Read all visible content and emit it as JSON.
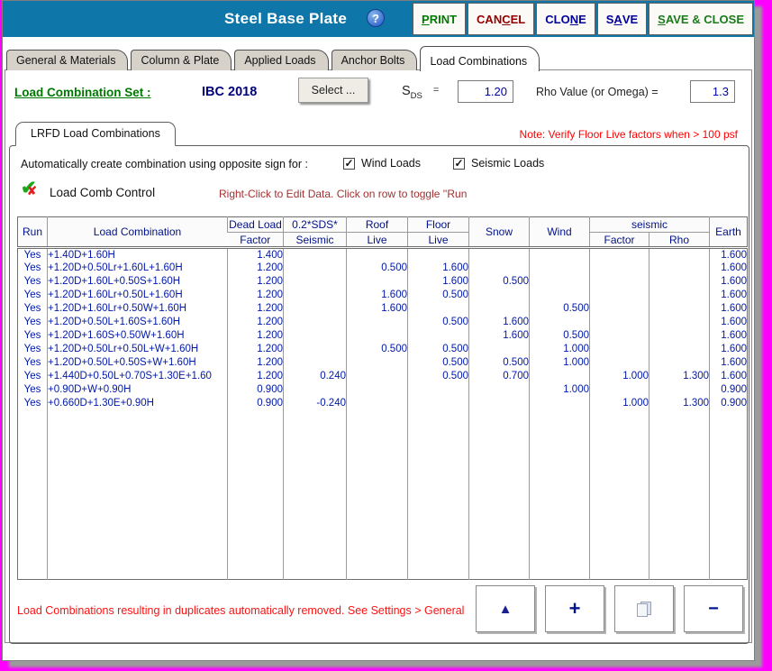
{
  "colors": {
    "titlebar": "#0F76A9",
    "desktop": "#FF00FF",
    "note_red": "#FF0000",
    "table_text": "#0018A8"
  },
  "titlebar": {
    "title": "Steel Base Plate",
    "help": "?",
    "buttons": [
      {
        "id": "print",
        "pre": "",
        "u": "P",
        "post": "RINT",
        "color": "#007A00"
      },
      {
        "id": "cancel",
        "pre": "CAN",
        "u": "C",
        "post": "EL",
        "color": "#8F0000"
      },
      {
        "id": "clone",
        "pre": "CLO",
        "u": "N",
        "post": "E",
        "color": "#000099"
      },
      {
        "id": "save",
        "pre": "S",
        "u": "A",
        "post": "VE",
        "color": "#000099"
      },
      {
        "id": "save-close",
        "pre": "",
        "u": "S",
        "post": "AVE & CLOSE",
        "color": "#1B7A1B"
      }
    ]
  },
  "tabs": [
    {
      "id": "general-materials",
      "label": "General & Materials",
      "active": false
    },
    {
      "id": "column-plate",
      "label": "Column & Plate",
      "active": false
    },
    {
      "id": "applied-loads",
      "label": "Applied Loads",
      "active": false
    },
    {
      "id": "anchor-bolts",
      "label": "Anchor Bolts",
      "active": false
    },
    {
      "id": "load-combinations",
      "label": "Load Combinations",
      "active": true
    }
  ],
  "fields": {
    "set_label": "Load Combination Set :",
    "set_value": "IBC 2018",
    "select_button": "Select ...",
    "sds": {
      "s": "S",
      "sub": "DS",
      "eq": "=",
      "value": "1.20"
    },
    "rho": {
      "label": "Rho Value (or Omega)  =",
      "value": "1.3"
    }
  },
  "lrfd": {
    "tab_label": "LRFD Load Combinations",
    "floor_note": "Note: Verify Floor Live factors when > 100 psf"
  },
  "auto_row": {
    "label": "Automatically create combination using opposite sign for :",
    "checkboxes": [
      {
        "id": "wind-loads",
        "label": "Wind Loads",
        "checked": true
      },
      {
        "id": "seismic-loads",
        "label": "Seismic Loads",
        "checked": true
      }
    ]
  },
  "lcc": {
    "label": "Load Comb Control",
    "note": "Right-Click to Edit Data. Click on row to toggle ''Run"
  },
  "table": {
    "header": {
      "run": "Run",
      "load_combination": "Load Combination",
      "dead_top": "Dead Load",
      "dead_bot": "Factor",
      "sds_top": "0.2*SDS*",
      "sds_bot": "Seismic",
      "roof_top": "Roof",
      "roof_bot": "Live",
      "floor_top": "Floor",
      "floor_bot": "Live",
      "snow": "Snow",
      "wind": "Wind",
      "seismic_group": "seismic",
      "seismic_factor": "Factor",
      "seismic_rho": "Rho",
      "earth": "Earth"
    },
    "rows": [
      [
        "Yes",
        "+1.40D+1.60H",
        "1.400",
        "",
        "",
        "",
        "",
        "",
        "",
        "",
        "1.600"
      ],
      [
        "Yes",
        "+1.20D+0.50Lr+1.60L+1.60H",
        "1.200",
        "",
        "0.500",
        "1.600",
        "",
        "",
        "",
        "",
        "1.600"
      ],
      [
        "Yes",
        "+1.20D+1.60L+0.50S+1.60H",
        "1.200",
        "",
        "",
        "1.600",
        "0.500",
        "",
        "",
        "",
        "1.600"
      ],
      [
        "Yes",
        "+1.20D+1.60Lr+0.50L+1.60H",
        "1.200",
        "",
        "1.600",
        "0.500",
        "",
        "",
        "",
        "",
        "1.600"
      ],
      [
        "Yes",
        "+1.20D+1.60Lr+0.50W+1.60H",
        "1.200",
        "",
        "1.600",
        "",
        "",
        "0.500",
        "",
        "",
        "1.600"
      ],
      [
        "Yes",
        "+1.20D+0.50L+1.60S+1.60H",
        "1.200",
        "",
        "",
        "0.500",
        "1.600",
        "",
        "",
        "",
        "1.600"
      ],
      [
        "Yes",
        "+1.20D+1.60S+0.50W+1.60H",
        "1.200",
        "",
        "",
        "",
        "1.600",
        "0.500",
        "",
        "",
        "1.600"
      ],
      [
        "Yes",
        "+1.20D+0.50Lr+0.50L+W+1.60H",
        "1.200",
        "",
        "0.500",
        "0.500",
        "",
        "1.000",
        "",
        "",
        "1.600"
      ],
      [
        "Yes",
        "+1.20D+0.50L+0.50S+W+1.60H",
        "1.200",
        "",
        "",
        "0.500",
        "0.500",
        "1.000",
        "",
        "",
        "1.600"
      ],
      [
        "Yes",
        "+1.440D+0.50L+0.70S+1.30E+1.60",
        "1.200",
        "0.240",
        "",
        "0.500",
        "0.700",
        "",
        "1.000",
        "1.300",
        "1.600"
      ],
      [
        "Yes",
        "+0.90D+W+0.90H",
        "0.900",
        "",
        "",
        "",
        "",
        "1.000",
        "",
        "",
        "0.900"
      ],
      [
        "Yes",
        "+0.660D+1.30E+0.90H",
        "0.900",
        "-0.240",
        "",
        "",
        "",
        "",
        "1.000",
        "1.300",
        "0.900"
      ]
    ]
  },
  "bottom": {
    "note": "Load Combinations resulting in duplicates automatically removed. See Settings > General",
    "buttons": [
      {
        "id": "triangle",
        "icon": "triangle-up-icon"
      },
      {
        "id": "add-row",
        "icon": "plus-icon"
      },
      {
        "id": "copy-row",
        "icon": "copy-icon"
      },
      {
        "id": "delete-row",
        "icon": "minus-icon"
      }
    ]
  }
}
